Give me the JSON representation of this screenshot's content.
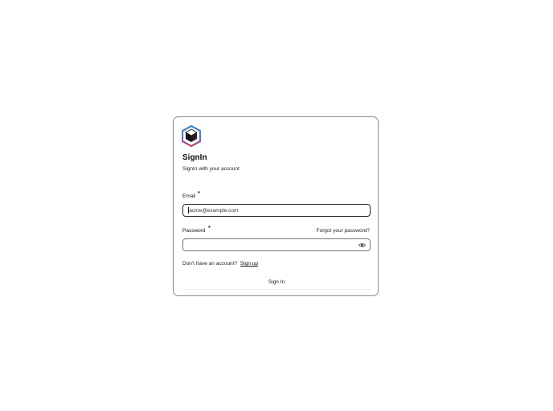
{
  "card": {
    "title": "SignIn",
    "subtitle": "SignIn with your account"
  },
  "email": {
    "label": "Email",
    "required_marker": "*",
    "value": "acme@example.com"
  },
  "password": {
    "label": "Password",
    "required_marker": "*",
    "value": "",
    "forgot_link": "Forgot your password?",
    "toggle_icon": "eye-icon"
  },
  "signup": {
    "prompt": "Don't have an account?",
    "link": "Sign up"
  },
  "submit": {
    "label": "Sign In"
  },
  "colors": {
    "logo_primary": "#3d8cd0",
    "logo_secondary": "#c0427e",
    "border": "#8a8a8a"
  }
}
